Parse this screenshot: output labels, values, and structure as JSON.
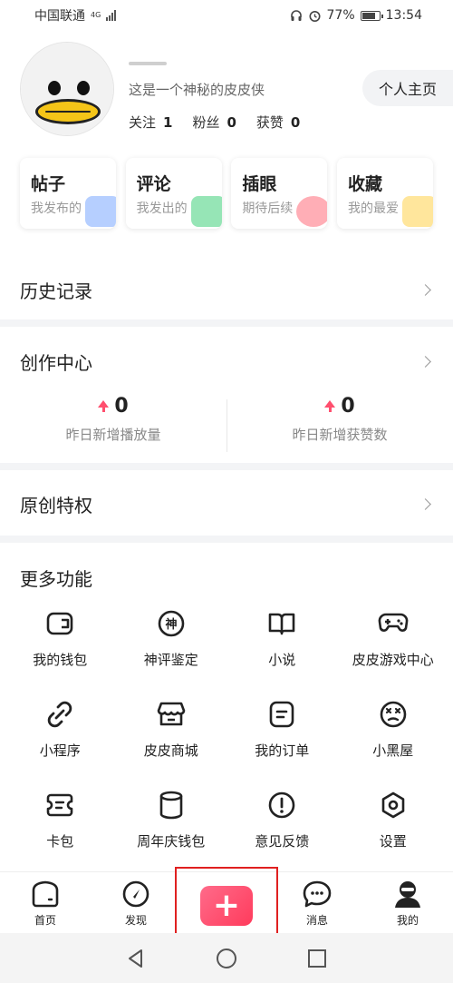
{
  "status_bar": {
    "carrier": "中国联通",
    "network": "4G",
    "battery_pct": "77%",
    "time": "13:54"
  },
  "profile": {
    "bio": "这是一个神秘的皮皮侠",
    "home_button": "个人主页",
    "stats": [
      {
        "label": "关注",
        "value": "1"
      },
      {
        "label": "粉丝",
        "value": "0"
      },
      {
        "label": "获赞",
        "value": "0"
      }
    ]
  },
  "quick_cards": [
    {
      "title": "帖子",
      "subtitle": "我发布的",
      "color": "#7aa7ff"
    },
    {
      "title": "评论",
      "subtitle": "我发出的",
      "color": "#3fcf7a"
    },
    {
      "title": "插眼",
      "subtitle": "期待后续",
      "color": "#ff6b7a"
    },
    {
      "title": "收藏",
      "subtitle": "我的最爱",
      "color": "#ffd24a"
    }
  ],
  "history": {
    "title": "历史记录"
  },
  "creator_center": {
    "title": "创作中心",
    "stats": [
      {
        "value": "0",
        "label": "昨日新增播放量"
      },
      {
        "value": "0",
        "label": "昨日新增获赞数"
      }
    ]
  },
  "original_privileges": {
    "title": "原创特权"
  },
  "more_features": {
    "title": "更多功能",
    "items": [
      {
        "label": "我的钱包",
        "icon": "wallet-icon"
      },
      {
        "label": "神评鉴定",
        "icon": "shen-badge-icon"
      },
      {
        "label": "小说",
        "icon": "book-icon"
      },
      {
        "label": "皮皮游戏中心",
        "icon": "gamepad-icon"
      },
      {
        "label": "小程序",
        "icon": "link-icon"
      },
      {
        "label": "皮皮商城",
        "icon": "store-icon"
      },
      {
        "label": "我的订单",
        "icon": "order-icon"
      },
      {
        "label": "小黑屋",
        "icon": "dizzy-face-icon"
      },
      {
        "label": "卡包",
        "icon": "card-pack-icon"
      },
      {
        "label": "周年庆钱包",
        "icon": "jar-icon"
      },
      {
        "label": "意见反馈",
        "icon": "feedback-icon"
      },
      {
        "label": "设置",
        "icon": "settings-icon"
      }
    ]
  },
  "tabbar": {
    "items": [
      {
        "label": "首页"
      },
      {
        "label": "发现"
      },
      {
        "label": "+"
      },
      {
        "label": "消息"
      },
      {
        "label": "我的"
      }
    ],
    "accent": "#ff4f6e",
    "highlight_border": "#e02020"
  }
}
